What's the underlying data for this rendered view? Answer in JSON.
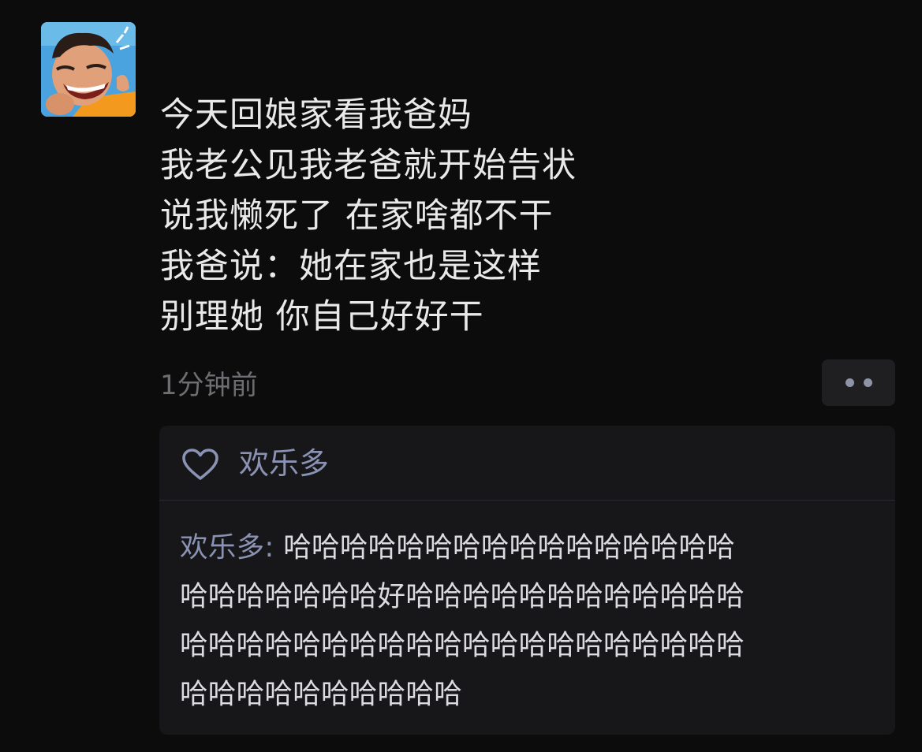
{
  "post": {
    "lines": [
      "今天回娘家看我爸妈",
      "我老公见我老爸就开始告状",
      "说我懒死了 在家啥都不干",
      "我爸说：她在家也是这样",
      "别理她 你自己好好干"
    ],
    "timestamp": "1分钟前"
  },
  "likes": {
    "names": "欢乐多"
  },
  "comment": {
    "author": "欢乐多:",
    "line1": " 哈哈哈哈哈哈哈哈哈哈哈哈哈哈哈哈",
    "line2": "哈哈哈哈哈哈哈好哈哈哈哈哈哈哈哈哈哈哈哈",
    "line3": "哈哈哈哈哈哈哈哈哈哈哈哈哈哈哈哈哈哈哈哈",
    "line4": "哈哈哈哈哈哈哈哈哈哈"
  },
  "colors": {
    "background": "#0c0c0d",
    "text": "#e9e9ea",
    "name_link": "#8b93b4",
    "muted": "#6e6e72",
    "panel": "#17171a"
  },
  "icons": {
    "avatar": "cartoon-avatar",
    "like": "heart-outline-icon",
    "more": "more-dots-icon"
  }
}
